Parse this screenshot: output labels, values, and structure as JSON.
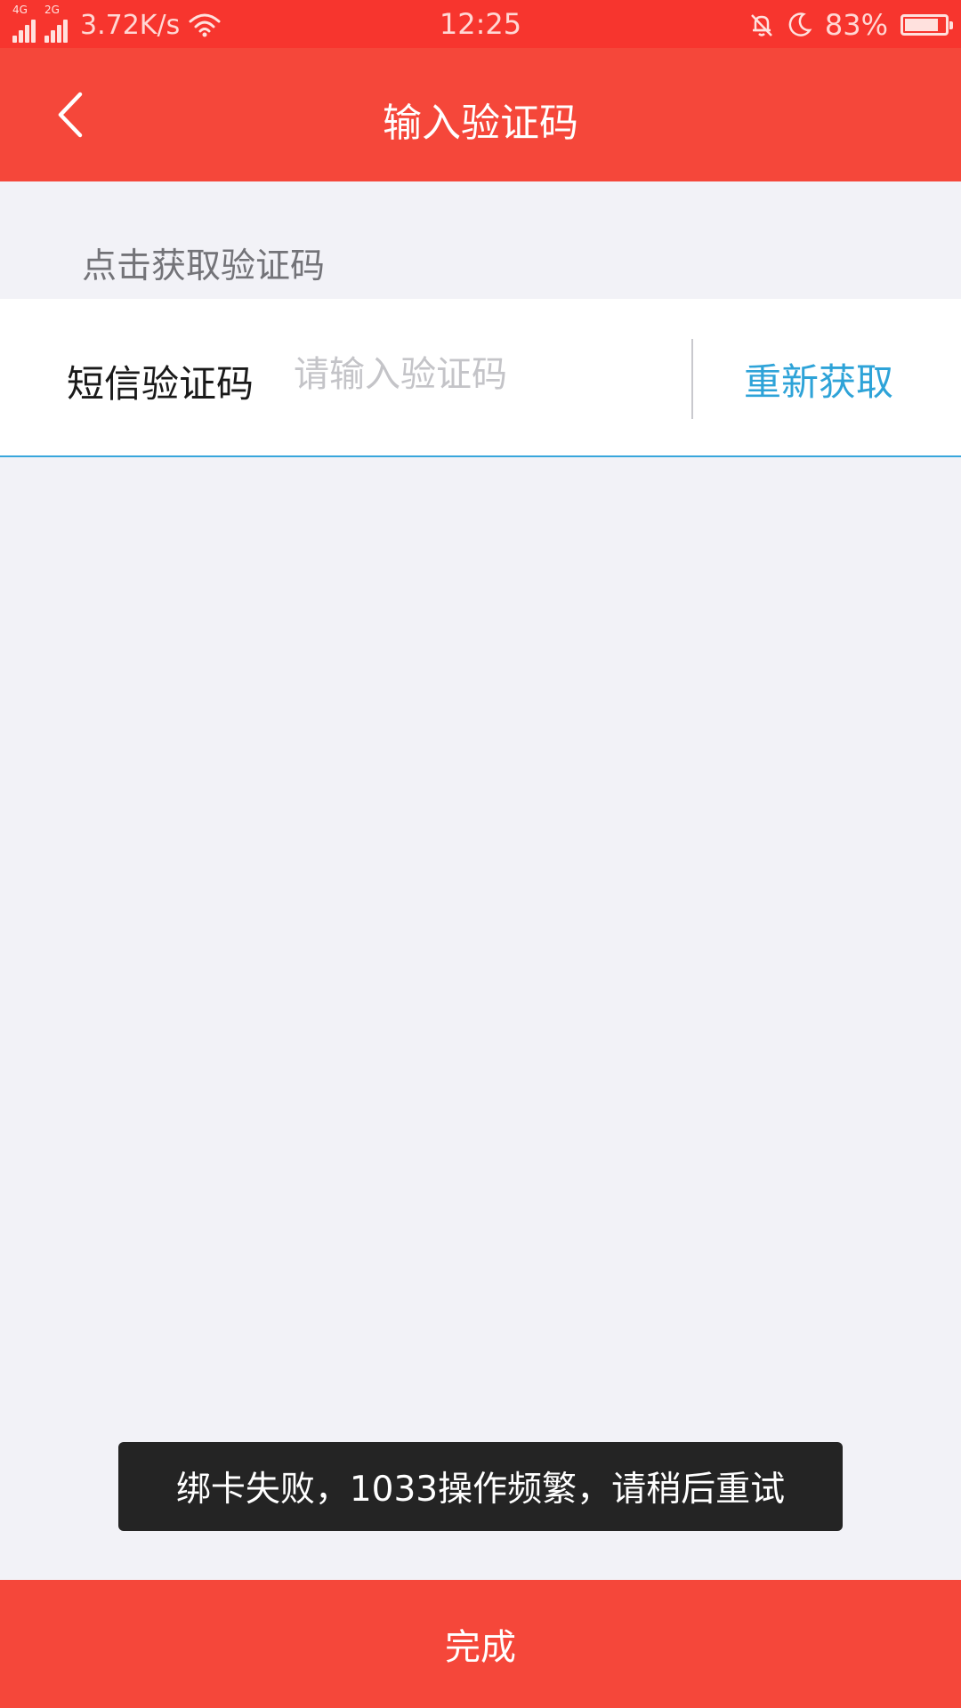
{
  "status_bar": {
    "net_speed": "3.72K/s",
    "time": "12:25",
    "battery": "83%",
    "battery_level": 0.83,
    "sim1_tag": "4G",
    "sim2_tag": "2G",
    "icons": [
      "signal-icon",
      "signal-icon",
      "wifi-icon",
      "mute-bell-icon",
      "moon-icon",
      "battery-icon"
    ]
  },
  "nav": {
    "title": "输入验证码",
    "back_icon": "chevron-left-icon"
  },
  "hint": "点击获取验证码",
  "sms_row": {
    "label": "短信验证码",
    "value": "",
    "placeholder": "请输入验证码",
    "resend_label": "重新获取"
  },
  "toast": "绑卡失败，1033操作频繁，请稍后重试",
  "done_label": "完成",
  "colors": {
    "primary_red": "#f5473a",
    "status_red": "#f7352e",
    "link_blue": "#2ea3d8",
    "background": "#f2f2f7",
    "toast_bg": "#242424"
  }
}
